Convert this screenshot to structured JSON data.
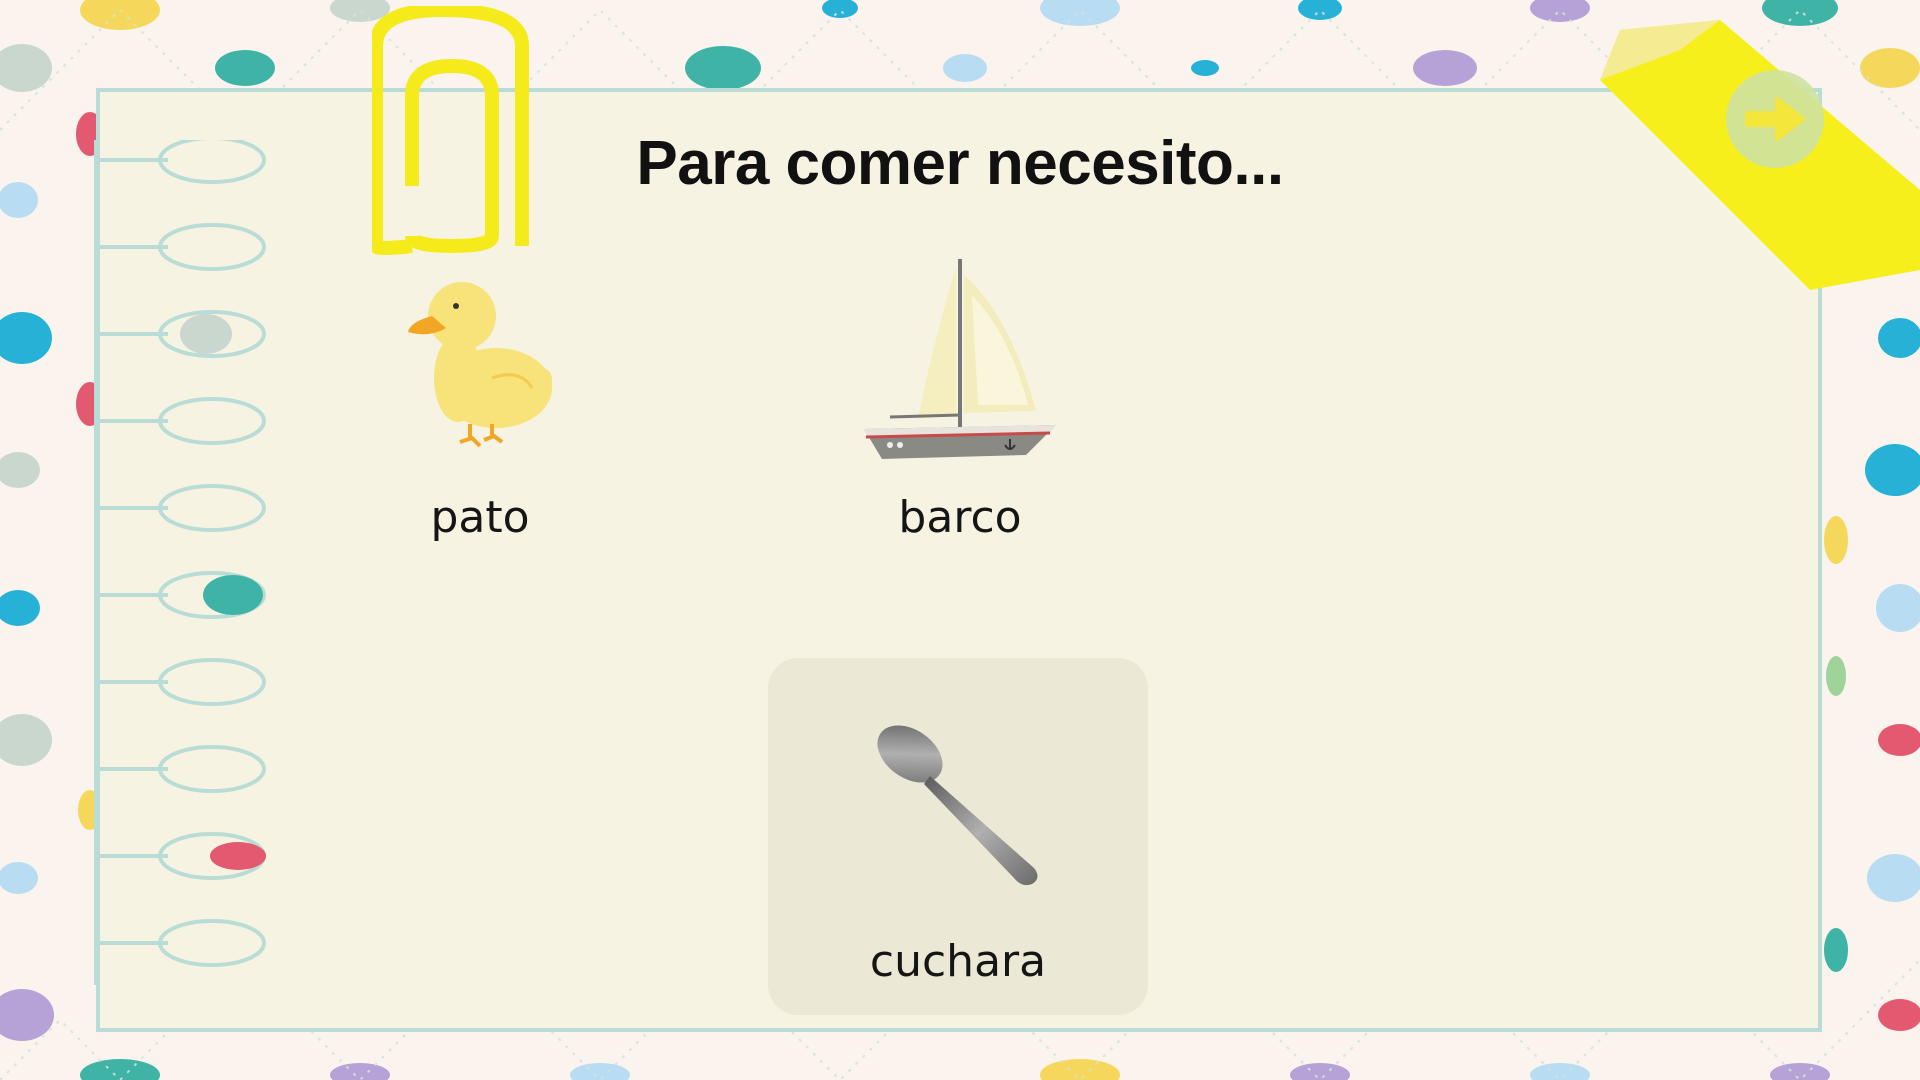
{
  "question": "Para comer necesito...",
  "options": [
    {
      "label": "pato",
      "icon": "duck-icon"
    },
    {
      "label": "barco",
      "icon": "sailboat-icon"
    },
    {
      "label": "cuchara",
      "icon": "spoon-icon",
      "selected": true
    }
  ],
  "next_button": {
    "icon": "arrow-right-icon"
  },
  "colors": {
    "paper": "#f6f3e2",
    "selected_card": "#ebe8d5",
    "next_button": "#cfe3a1",
    "arrow": "#f4e63f",
    "pencil": "#f7ef1c"
  }
}
